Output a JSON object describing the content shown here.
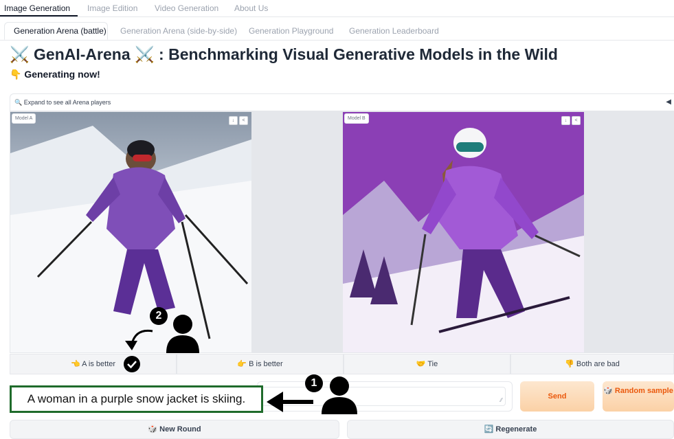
{
  "top_tabs": [
    "Image Generation",
    "Image Edition",
    "Video Generation",
    "About Us"
  ],
  "sub_tabs": [
    "Generation Arena (battle)",
    "Generation Arena (side-by-side)",
    "Generation Playground",
    "Generation Leaderboard"
  ],
  "title": "⚔️ GenAI-Arena ⚔️ : Benchmarking Visual Generative Models in the Wild",
  "status": "👇 Generating now!",
  "accordion": {
    "label": "🔍 Expand to see all Arena players",
    "toggle": "◀"
  },
  "panels": {
    "model_a": "Model A",
    "model_b": "Model B"
  },
  "vote_buttons": {
    "a_better": "👈 A is better",
    "b_better": "👉 B is better",
    "tie": "🤝 Tie",
    "both_bad": "👎 Both are bad"
  },
  "prompt": {
    "text": "A woman in a purple snow jacket is skiing."
  },
  "buttons": {
    "send": "Send",
    "random_sample": "🎲 Random sample",
    "new_round": "🎲 New Round",
    "regenerate": "🔄 Regenerate"
  },
  "annotations": {
    "step1": "1",
    "step2": "2"
  },
  "colors": {
    "accent_orange": "#ea580c",
    "annotation_green": "#1f6b2b"
  }
}
